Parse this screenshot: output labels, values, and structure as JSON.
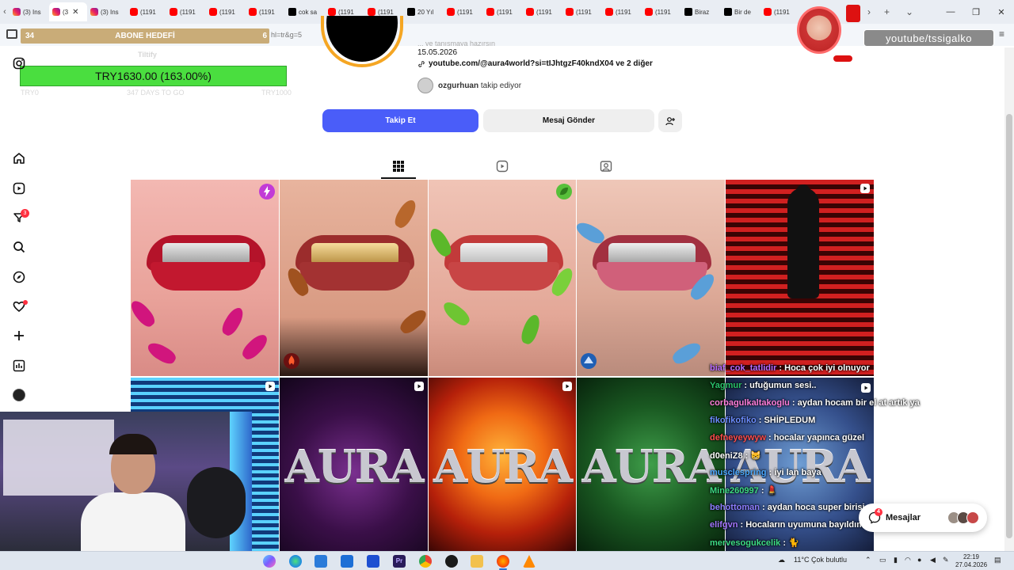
{
  "browser": {
    "tabs": [
      {
        "label": "(3) Ins",
        "favicon": "instagram-icon",
        "active": false
      },
      {
        "label": "(3",
        "favicon": "instagram-icon",
        "active": true
      },
      {
        "label": "(3) Ins",
        "favicon": "instagram-icon",
        "active": false
      },
      {
        "label": "(1191",
        "favicon": "youtube-icon",
        "active": false
      },
      {
        "label": "(1191",
        "favicon": "youtube-icon",
        "active": false
      },
      {
        "label": "(1191",
        "favicon": "youtube-icon",
        "active": false
      },
      {
        "label": "(1191",
        "favicon": "youtube-icon",
        "active": false
      },
      {
        "label": "cok sa",
        "favicon": "tiktok-icon",
        "active": false
      },
      {
        "label": "(1191",
        "favicon": "youtube-icon",
        "active": false
      },
      {
        "label": "(1191",
        "favicon": "youtube-icon",
        "active": false
      },
      {
        "label": "20 Yıl",
        "favicon": "tiktok-icon",
        "active": false
      },
      {
        "label": "(1191",
        "favicon": "youtube-icon",
        "active": false
      },
      {
        "label": "(1191",
        "favicon": "youtube-icon",
        "active": false
      },
      {
        "label": "(1191",
        "favicon": "youtube-icon",
        "active": false
      },
      {
        "label": "(1191",
        "favicon": "youtube-icon",
        "active": false
      },
      {
        "label": "(1191",
        "favicon": "youtube-icon",
        "active": false
      },
      {
        "label": "(1191",
        "favicon": "youtube-icon",
        "active": false
      },
      {
        "label": "Biraz",
        "favicon": "tiktok-icon",
        "active": false
      },
      {
        "label": "Bir de",
        "favicon": "tiktok-icon",
        "active": false
      },
      {
        "label": "(1191",
        "favicon": "youtube-icon",
        "active": false
      }
    ],
    "new_tab": "+",
    "url_fragment": "hl=tr&g=5"
  },
  "stream_overlay": {
    "goal_left": "34",
    "goal_title": "ABONE HEDEFİ",
    "goal_right": "6",
    "tiltify": "Tiltify",
    "donation_amount": "TRY1630.00 (163.00%)",
    "donation_progress_percent": 163,
    "foot_left": "TRY0",
    "foot_mid": "347 DAYS TO GO",
    "foot_right": "TRY1000",
    "streamer_handle": "youtube/tssigalko"
  },
  "profile": {
    "bio_top": "... ve tanışmaya hazırsın",
    "date": "15.05.2026",
    "link": "youtube.com/@aura4world?si=tIJhtgzF40kndX04 ve 2 diğer",
    "followed_by_user": "ozgurhuan",
    "followed_by_text": "takip ediyor",
    "follow_button": "Takip Et",
    "message_button": "Mesaj Gönder"
  },
  "chat": [
    {
      "user": "biaf_cok_tatlidir",
      "text": ": Hoca çok iyi olnuyor",
      "color": "#b96bff"
    },
    {
      "user": "Yagmur",
      "text": ": ufuğumun sesi..",
      "color": "#29c36a"
    },
    {
      "user": "corbagulkaltakoglu",
      "text": ": aydan hocam bir el at artık ya",
      "color": "#ff7edb"
    },
    {
      "user": "fikofikofiko",
      "text": ": SHİPLEDUM",
      "color": "#6c8dff"
    },
    {
      "user": "defneyeywyw",
      "text": ": hocalar yapınca güzel",
      "color": "#ff4d4d"
    },
    {
      "user": "d0eniZ8",
      "text": ": 😸",
      "color": "#ffffff"
    },
    {
      "user": "musclespring",
      "text": ": iyi lan baya",
      "color": "#4aa8ff"
    },
    {
      "user": "Mine260997",
      "text": ": 💄",
      "color": "#3ddc84"
    },
    {
      "user": "behottoman",
      "text": ": aydan hoca super birisi",
      "color": "#8e7dff"
    },
    {
      "user": "elifgvn",
      "text": ": Hocaların uyumuna bayıldım",
      "color": "#a276ff"
    },
    {
      "user": "mervesogukcelik",
      "text": ": 🐈",
      "color": "#3ddc84"
    }
  ],
  "messages_panel": {
    "label": "Mesajlar",
    "badge": "4"
  },
  "nav": {
    "notifications_badge": "3"
  },
  "taskbar": {
    "weather": "11°C  Çok bulutlu",
    "time": "22:19",
    "date": "27.04.2026"
  },
  "posts": [
    {
      "type": "image",
      "theme": "pink-grillz",
      "badge": "pink-bolt-icon"
    },
    {
      "type": "image",
      "theme": "gold-grillz",
      "badge": ""
    },
    {
      "type": "image",
      "theme": "green-grillz",
      "badge": "green-leaf-icon"
    },
    {
      "type": "image",
      "theme": "blue-grillz",
      "badge": ""
    },
    {
      "type": "reel",
      "theme": "red-silhouette",
      "badge": "reel-icon"
    },
    {
      "type": "reel",
      "theme": "blue-stripes",
      "badge": "reel-icon"
    },
    {
      "type": "reel",
      "theme": "purple-aura",
      "badge": "reel-icon",
      "title": "AURA"
    },
    {
      "type": "reel",
      "theme": "fire-aura",
      "badge": "reel-icon",
      "title": "AURA"
    },
    {
      "type": "reel",
      "theme": "green-aura",
      "badge": "reel-icon",
      "title": "AURA"
    },
    {
      "type": "reel",
      "theme": "blue-aura",
      "badge": "",
      "title": "AURA"
    }
  ]
}
